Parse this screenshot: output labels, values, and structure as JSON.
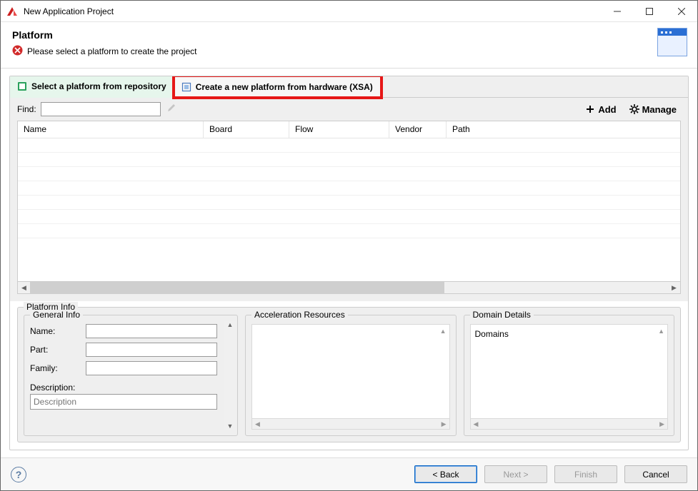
{
  "window": {
    "title": "New Application Project"
  },
  "header": {
    "title": "Platform",
    "message": "Please select a platform to create the project"
  },
  "tabs": {
    "repo": {
      "label": "Select a platform from repository"
    },
    "xsa": {
      "label": "Create a new platform from hardware (XSA)"
    }
  },
  "find": {
    "label": "Find:",
    "value": ""
  },
  "actions": {
    "add": "Add",
    "manage": "Manage"
  },
  "table": {
    "columns": {
      "name": "Name",
      "board": "Board",
      "flow": "Flow",
      "vendor": "Vendor",
      "path": "Path"
    }
  },
  "platform_info": {
    "legend": "Platform Info",
    "general": {
      "legend": "General Info",
      "name_label": "Name:",
      "name_value": "",
      "part_label": "Part:",
      "part_value": "",
      "family_label": "Family:",
      "family_value": "",
      "description_label": "Description:",
      "description_placeholder": "Description"
    },
    "accel": {
      "legend": "Acceleration Resources"
    },
    "domain": {
      "legend": "Domain Details",
      "domains_label": "Domains"
    }
  },
  "footer": {
    "back": "< Back",
    "next": "Next >",
    "finish": "Finish",
    "cancel": "Cancel"
  }
}
